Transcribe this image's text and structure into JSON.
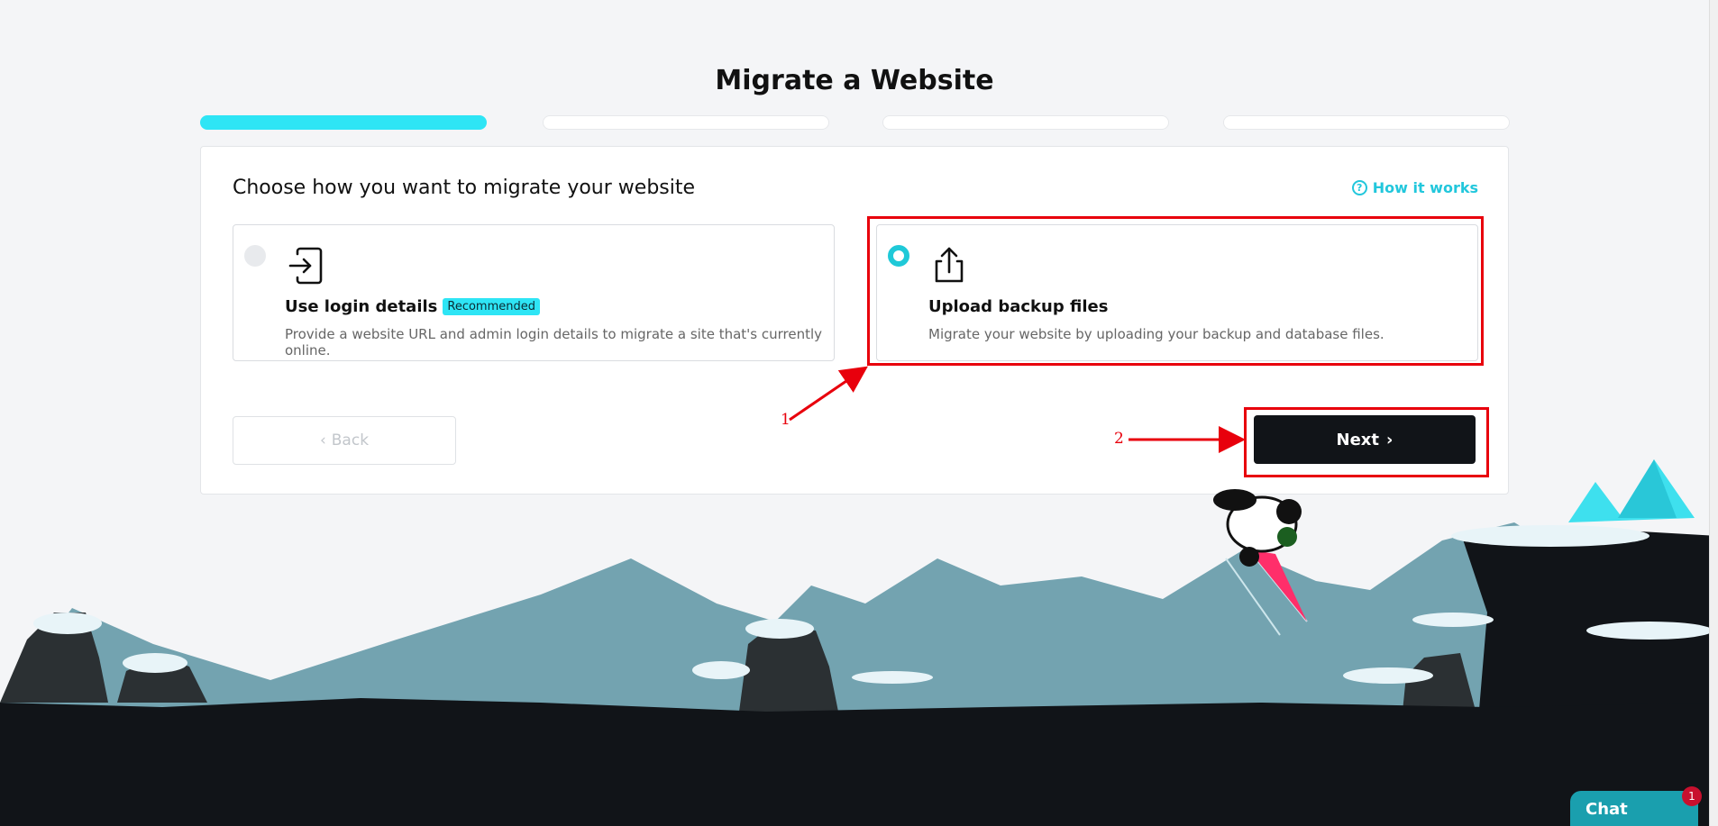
{
  "page": {
    "title": "Migrate a Website"
  },
  "progress": {
    "steps_total": 4,
    "current_step": 1
  },
  "card": {
    "title": "Choose how you want to migrate your website",
    "help_link": "How it works",
    "options": [
      {
        "title": "Use login details",
        "badge": "Recommended",
        "description": "Provide a website URL and admin login details to migrate a site that's currently online.",
        "selected": false,
        "icon": "login-arrow-icon"
      },
      {
        "title": "Upload backup files",
        "description": "Migrate your website by uploading your backup and database files.",
        "selected": true,
        "icon": "upload-icon"
      }
    ],
    "back_label": "Back",
    "next_label": "Next"
  },
  "annotations": {
    "label_1": "1",
    "label_2": "2"
  },
  "chat": {
    "label": "Chat",
    "badge_count": "1"
  },
  "colors": {
    "accent": "#2ee5f5",
    "primary_button": "#111418",
    "annotation": "#e8000c"
  }
}
